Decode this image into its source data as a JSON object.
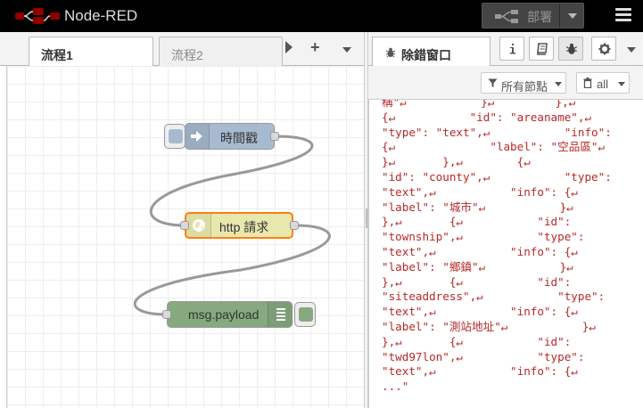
{
  "header": {
    "title": "Node-RED",
    "deploy_label": "部署"
  },
  "workspace": {
    "tabs": [
      {
        "label": "流程1",
        "active": true
      },
      {
        "label": "流程2",
        "active": false
      }
    ]
  },
  "nodes": [
    {
      "label": "時間戳",
      "type": "inject",
      "color": "#a6bbcf"
    },
    {
      "label": "http 請求",
      "type": "http-request",
      "color": "#e7e7ae"
    },
    {
      "label": "msg.payload",
      "type": "debug",
      "color": "#87a980"
    }
  ],
  "sidebar": {
    "tab_label": "除錯窗口",
    "filter_nodes_label": "所有節點",
    "filter_all_label": "all",
    "debug_lines": [
      "稱\"↵           }↵         },↵",
      "{↵           \"id\": \"areaname\",↵",
      "\"type\": \"text\",↵           \"info\":",
      "{↵              \"label\": \"空品區\"↵",
      "}↵       },↵        {↵",
      "\"id\": \"county\",↵           \"type\":",
      "\"text\",↵           \"info\": {↵",
      "\"label\": \"城市\"↵           }↵",
      "},↵       {↵           \"id\":",
      "\"township\",↵           \"type\":",
      "\"text\",↵           \"info\": {↵",
      "\"label\": \"鄉鎮\"↵           }↵",
      "},↵       {↵           \"id\":",
      "\"siteaddress\",↵           \"type\":",
      "\"text\",↵           \"info\": {↵",
      "\"label\": \"測站地址\"↵           }↵",
      "},↵       {↵           \"id\":",
      "\"twd97lon\",↵           \"type\":",
      "\"text\",↵           \"info\": {↵",
      "...\""
    ]
  },
  "colors": {
    "header_bg": "#000000",
    "inject_node": "#a6bbcf",
    "http_node": "#e7e7ae",
    "debug_node": "#87a980",
    "selected_border": "#ff7f0e",
    "debug_text": "#b72828",
    "wire": "#999999"
  }
}
